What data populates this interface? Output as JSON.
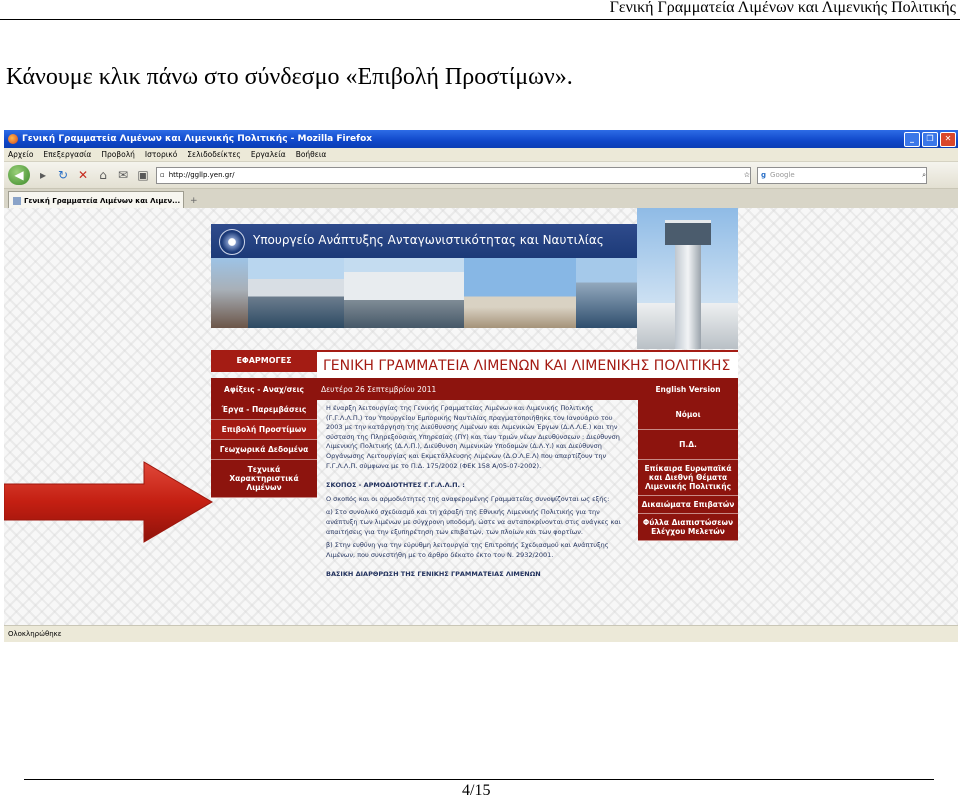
{
  "document": {
    "running_header": "Γενική Γραμματεία Λιμένων και Λιμενικής Πολιτικής",
    "intro": "Κάνουμε κλικ πάνω στο σύνδεσμο «Επιβολή Προστίμων».",
    "page_number": "4/15"
  },
  "browser": {
    "window_title": "Γενική Γραμματεία Λιμένων και Λιμενικής Πολιτικής - Mozilla Firefox",
    "menu": [
      "Αρχείο",
      "Επεξεργασία",
      "Προβολή",
      "Ιστορικό",
      "Σελιδοδείκτες",
      "Εργαλεία",
      "Βοήθεια"
    ],
    "url": "http://ggllp.yen.gr/",
    "search_placeholder": "Google",
    "tab_title": "Γενική Γραμματεία Λιμένων και Λιμεν...",
    "status": "Ολοκληρώθηκε",
    "window_buttons": [
      "_",
      "❐",
      "✕"
    ]
  },
  "site": {
    "banner": "Υπουργείο Ανάπτυξης Ανταγωνιστικότητας και Ναυτιλίας",
    "apps": "ΕΦΑΡΜΟΓΕΣ",
    "title": "ΓΕΝΙΚΗ ΓΡΑΜΜΑΤΕΙΑ ΛΙΜΕΝΩΝ ΚΑΙ ΛΙΜΕΝΙΚΗΣ ΠΟΛΙΤΙΚΗΣ",
    "arrivals": "Αφίξεις - Αναχ/σεις",
    "date": "Δευτέρα 26 Σεπτεμβρίου 2011",
    "english": "English Version",
    "left_nav": [
      "Έργα - Παρεμβάσεις",
      "Επιβολή Προστίμων",
      "Γεωχωρικά Δεδομένα",
      "Τεχνικά Χαρακτηριστικά Λιμένων"
    ],
    "right_nav": [
      "Νόμοι",
      "Π.Δ.",
      "Επίκαιρα Ευρωπαϊκά και Διεθνή Θέματα Λιμενικής Πολιτικής",
      "Δικαιώματα Επιβατών",
      "Φύλλα Διαπιστώσεων Ελέγχου Μελετών"
    ],
    "paragraph1": "Η έναρξη λειτουργίας της Γενικής Γραμματείας Λιμένων και Λιμενικής Πολιτικής (Γ.Γ.Λ.Λ.Π.) του Υπουργείου Εμπορικής Ναυτιλίας πραγματοποιήθηκε τον Ιανουάριο του 2003 με την κατάργηση της Διεύθυνσης Λιμένων και Λιμενικών Έργων (Δ.Λ.Λ.Ε.) και την σύσταση της Πληρεξούσιας Υπηρεσίας (ΠΥ) και των τριών νέων Διευθύνσεων : Διεύθυνση Λιμενικής Πολιτικής (Δ.Λ.Π.), Διεύθυνση Λιμενικών Υποδομών (Δ.Λ.Υ.) και Διεύθυνση Οργάνωσης Λειτουργίας και Εκμετάλλευσης Λιμένων (Δ.Ο.Λ.Ε.Λ) που απαρτίζουν την Γ.Γ.Λ.Λ.Π. σύμφωνα με το Π.Δ. 175/2002 (ΦΕΚ 158 Α/05-07-2002).",
    "heading": "ΣΚΟΠΟΣ - ΑΡΜΟΔΙΟΤΗΤΕΣ Γ.Γ.Λ.Λ.Π. :",
    "paragraph2": "Ο σκοπός και οι αρμοδιότητες της αναφερομένης Γραμματείας συνοψίζονται ως εξής:",
    "item_a": "α) Στο συνολικό σχεδιασμό και τη χάραξη της Εθνικής Λιμενικής Πολιτικής για την ανάπτυξη των λιμένων με σύγχρονη υποδομή, ώστε να ανταποκρίνονται στις ανάγκες και απαιτήσεις για την εξυπηρέτηση των επιβατών, των πλοίων και των φορτίων.",
    "item_b": "β) Στην ευθύνη για την εύρυθμη λειτουργία της Επιτροπής Σχεδιασμού και Ανάπτυξης Λιμένων, που συνεστήθη με το άρθρο δέκατο έκτο του Ν. 2932/2001.",
    "truncated": "ΒΑΣΙΚΗ ΔΙΑΡΘΡΩΣΗ ΤΗΣ ΓΕΝΙΚΗΣ ΓΡΑΜΜΑΤΕΙΑΣ ΛΙΜΕΝΩΝ"
  },
  "colors": {
    "site_red": "#8d140e",
    "titlebar_blue": "#0f47c9",
    "arrow_red": "#c41f12"
  }
}
